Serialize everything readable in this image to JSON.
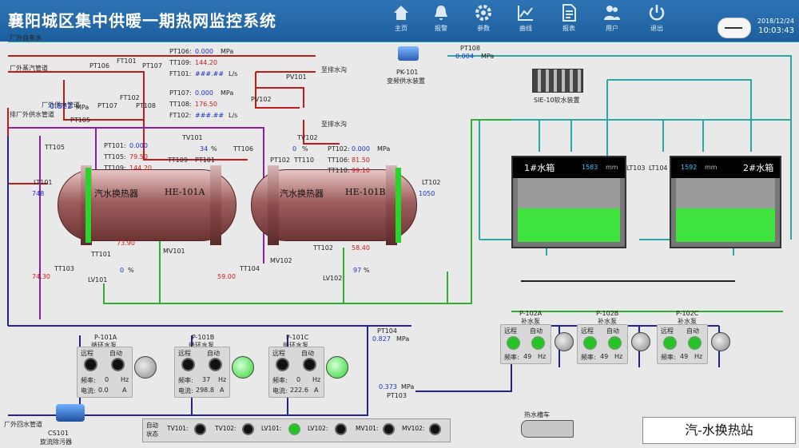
{
  "header": {
    "title": "襄阳城区集中供暖一期热网监控系统",
    "nav": [
      {
        "label": "主页",
        "icon": "home-icon"
      },
      {
        "label": "报警",
        "icon": "bell-icon"
      },
      {
        "label": "参数",
        "icon": "gear-icon"
      },
      {
        "label": "曲线",
        "icon": "chart-line-icon"
      },
      {
        "label": "报表",
        "icon": "document-icon"
      },
      {
        "label": "用户",
        "icon": "users-icon"
      },
      {
        "label": "退出",
        "icon": "power-icon"
      }
    ],
    "date": "2018/12/24",
    "time": "10:03:43"
  },
  "pipes": {
    "tap_water": "厂外自来水",
    "steam": "厂外蒸汽管道",
    "supply": "厂外供水管道",
    "return_out": "排厂外供水管道",
    "drain1": "至排水沟",
    "drain2": "至排水沟",
    "return_in": "厂外回水管道"
  },
  "instruments": {
    "pt106": "PT106",
    "ft101": "FT101",
    "pt107": "PT107",
    "pt108": "PT108",
    "ft102": "FT102",
    "pt105": "PT105",
    "pt105_val": "0.822",
    "unit_mpa": "MPa",
    "pt106_line": "PT106:",
    "pt106_val": "0.000",
    "tt109_line": "TT109:",
    "tt109_val": "144.20",
    "ft101_line": "FT101:",
    "ft101_val": "###.##",
    "unit_ls": "L/s",
    "pt107_line": "PT107:",
    "pt107_val": "0.000",
    "tt108_line": "TT108:",
    "tt108_val": "176.50",
    "ft102_line": "FT102:",
    "ft102_val": "###.##",
    "pv101": "PV101",
    "pv102": "PV102",
    "pk101": "PK-101",
    "pk101_desc": "变频供水装置",
    "pt108b": "PT108",
    "pt108b_val": "0.004",
    "sie": "SIE-10软水装置"
  },
  "hx1": {
    "name": "汽水换热器",
    "tag": "HE-101A",
    "tv101": "TV101",
    "tv101_val": "34",
    "pct": "%",
    "pt101_line": "PT101:",
    "pt101_val": "0.000",
    "tt105_line": "TT105:",
    "tt105_val": "79.50",
    "tt109_line": "TT109:",
    "tt109_val": "144.20",
    "tt105": "TT105",
    "tt109": "TT109",
    "pt101": "PT101",
    "lt101": "LT101",
    "lt101_val": "748",
    "temp_out": "73.90",
    "tt101": "TT101",
    "mv101": "MV101",
    "tt103": "TT103",
    "tt103_val": "74.30",
    "lv101": "LV101",
    "lv101_val": "0"
  },
  "hx2": {
    "name": "汽水换热器",
    "tag": "HE-101B",
    "tv102": "TV102",
    "tv102_val": "0",
    "pct": "%",
    "tt106": "TT106",
    "pt102_line": "PT102:",
    "pt102_val": "0.000",
    "tt106_line": "TT106:",
    "tt106_val": "81.50",
    "tt110_line": "TT110:",
    "tt110_val": "99.10",
    "pt102": "PT102",
    "tt110": "TT110",
    "lt102": "LT102",
    "lt102_val": "1050",
    "tt104": "TT104",
    "tt104_val": "59.00",
    "mv102": "MV102",
    "tt102": "TT102",
    "tt102_val": "58.40",
    "lv102": "LV102",
    "lv102_val": "97"
  },
  "tanks": [
    {
      "name": "1#水箱",
      "value": "1583",
      "unit": "mm",
      "level": 0.55,
      "lt": "LT103"
    },
    {
      "name": "2#水箱",
      "value": "1592",
      "unit": "mm",
      "level": 0.55,
      "lt": "LT104"
    }
  ],
  "make_up_pumps": [
    {
      "tag": "P-102A",
      "desc": "补水泵",
      "remote": "远程",
      "auto": "自动",
      "freq_label": "频率:",
      "freq": "49",
      "hz": "Hz",
      "running": false
    },
    {
      "tag": "P-102B",
      "desc": "补水泵",
      "remote": "远程",
      "auto": "自动",
      "freq_label": "频率:",
      "freq": "49",
      "hz": "Hz",
      "running": false
    },
    {
      "tag": "P-102C",
      "desc": "补水泵",
      "remote": "远程",
      "auto": "自动",
      "freq_label": "频率:",
      "freq": "49",
      "hz": "Hz",
      "running": false
    }
  ],
  "circ_pumps": [
    {
      "tag": "P-101A",
      "desc": "循环水泵",
      "remote": "远程",
      "auto": "自动",
      "freq_label": "频率:",
      "freq": "0",
      "hz": "Hz",
      "cur_label": "电流:",
      "cur": "0.0",
      "a": "A",
      "running": false
    },
    {
      "tag": "P-101B",
      "desc": "循环水泵",
      "remote": "远程",
      "auto": "自动",
      "freq_label": "频率:",
      "freq": "37",
      "hz": "Hz",
      "cur_label": "电流:",
      "cur": "298.8",
      "a": "A",
      "running": true
    },
    {
      "tag": "P-101C",
      "desc": "循环水泵",
      "remote": "远程",
      "auto": "自动",
      "freq_label": "频率:",
      "freq": "0",
      "hz": "Hz",
      "cur_label": "电流:",
      "cur": "222.6",
      "a": "A",
      "running": true
    }
  ],
  "misc": {
    "pt104": "PT104",
    "pt104_val": "0.827",
    "pt103": "PT103",
    "pt103_val": "0.373",
    "cs101": "CS101",
    "cs101_desc": "旋流除污器",
    "truck": "热水槽车",
    "station": "汽-水换热站"
  },
  "bottom": {
    "mode": "自动\n状态",
    "items": [
      {
        "label": "TV101:",
        "on": false
      },
      {
        "label": "TV102:",
        "on": false
      },
      {
        "label": "LV101:",
        "on": true
      },
      {
        "label": "LV102:",
        "on": false
      },
      {
        "label": "MV101:",
        "on": false
      },
      {
        "label": "MV102:",
        "on": false
      }
    ]
  },
  "colors": {
    "supply": "#c41a1a",
    "steam": "#8a1fa3",
    "return": "#23229e",
    "condensate": "#2fae2f",
    "make_up": "#2aa7a7"
  }
}
